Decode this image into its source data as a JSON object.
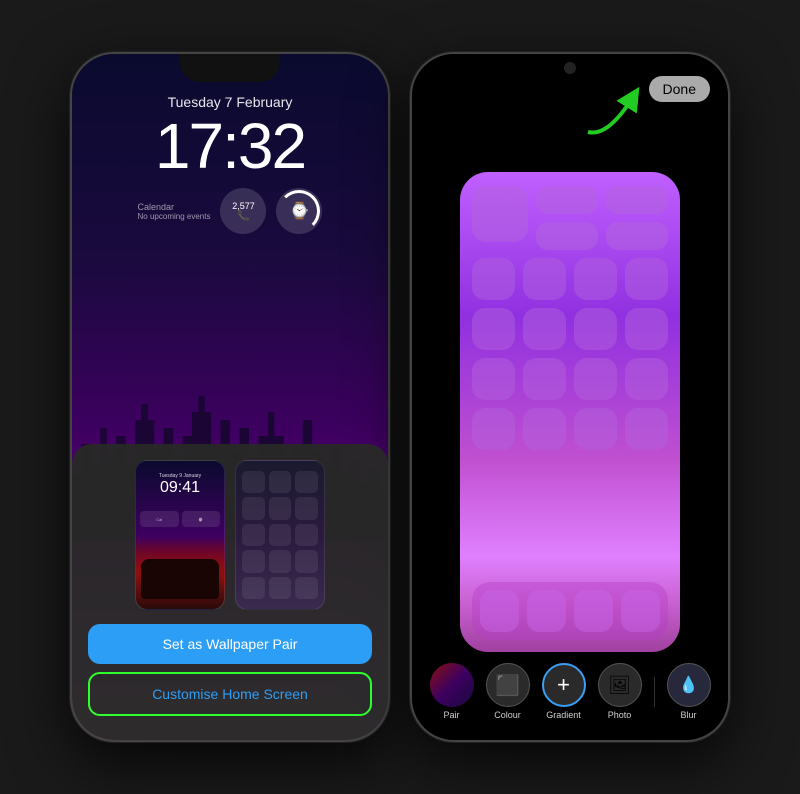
{
  "left_phone": {
    "lock_screen": {
      "date": "Tuesday 7 February",
      "time": "17:32",
      "calendar_label": "Calendar",
      "calendar_sub": "No upcoming events",
      "widget_number": "2,577"
    },
    "modal": {
      "btn_set_wallpaper": "Set as Wallpaper Pair",
      "btn_customise": "Customise Home Screen"
    }
  },
  "right_phone": {
    "done_button": "Done",
    "toolbar": {
      "items": [
        {
          "id": "pair",
          "label": "Pair"
        },
        {
          "id": "colour",
          "label": "Colour"
        },
        {
          "id": "gradient",
          "label": "Gradient"
        },
        {
          "id": "photo",
          "label": "Photo"
        },
        {
          "id": "blur",
          "label": "Blur"
        }
      ]
    }
  }
}
